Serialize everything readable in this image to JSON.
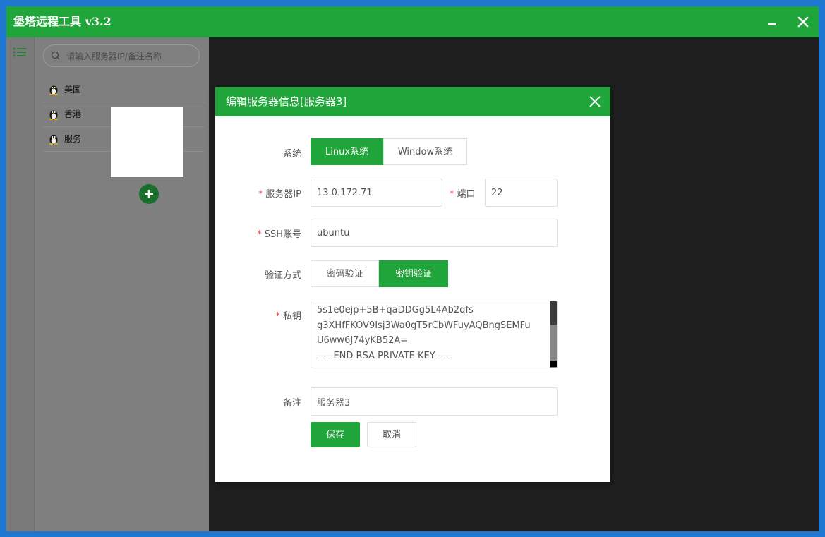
{
  "app": {
    "title": "堡塔远程工具 v3.2"
  },
  "sidebar": {
    "search_placeholder": "请输入服务器IP/备注名称",
    "servers": [
      {
        "name": "美国"
      },
      {
        "name": "香港"
      },
      {
        "name": "服务"
      }
    ]
  },
  "dialog": {
    "title": "编辑服务器信息[服务器3]",
    "system": {
      "label": "系统",
      "options": [
        "Linux系统",
        "Window系统"
      ],
      "selected": "Linux系统"
    },
    "ip": {
      "label": "服务器IP",
      "value": "13.0.172.71"
    },
    "port": {
      "label": "端口",
      "value": "22"
    },
    "ssh_user": {
      "label": "SSH账号",
      "value": "ubuntu"
    },
    "auth": {
      "label": "验证方式",
      "options": [
        "密码验证",
        "密钥验证"
      ],
      "selected": "密钥验证"
    },
    "private_key": {
      "label": "私钥",
      "visible_lines": [
        "5s1e0ejp+5B+qaDDGg5L4Ab2qfs",
        "g3XHfFKOV9Isj3Wa0gT5rCbWFuyAQBngSEMFu",
        "U6ww6J74yKB52A=",
        "-----END RSA PRIVATE KEY-----"
      ]
    },
    "remark": {
      "label": "备注",
      "value": "服务器3"
    },
    "save_label": "保存",
    "cancel_label": "取消"
  },
  "colors": {
    "brand_green": "#20a53a",
    "required_star": "#f04848",
    "desktop_blue": "#1e78d2"
  }
}
